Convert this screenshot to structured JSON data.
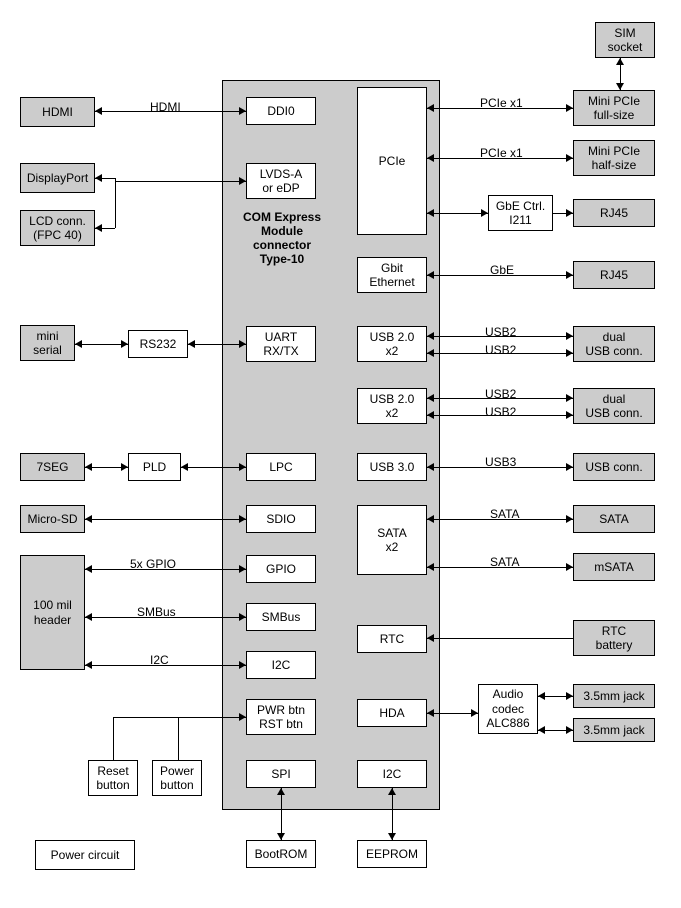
{
  "main": {
    "title": "COM Express\nModule\nconnector\nType-10"
  },
  "left_ext": {
    "hdmi": "HDMI",
    "displayport": "DisplayPort",
    "lcd": "LCD conn.\n(FPC 40)",
    "mini_serial": "mini\nserial",
    "seg7": "7SEG",
    "microsd": "Micro-SD",
    "header100": "100 mil\nheader",
    "power_circuit": "Power circuit"
  },
  "left_mid": {
    "rs232": "RS232",
    "pld": "PLD",
    "reset": "Reset\nbutton",
    "power": "Power\nbutton"
  },
  "left_inner": {
    "ddi0": "DDI0",
    "lvds": "LVDS-A\nor eDP",
    "uart": "UART\nRX/TX",
    "lpc": "LPC",
    "sdio": "SDIO",
    "gpio": "GPIO",
    "smbus": "SMBus",
    "i2c": "I2C",
    "pwrbtn": "PWR btn\nRST btn",
    "spi": "SPI"
  },
  "right_inner": {
    "pcie": "PCIe",
    "gbit": "Gbit\nEthernet",
    "usb20a": "USB 2.0\nx2",
    "usb20b": "USB 2.0\nx2",
    "usb30": "USB 3.0",
    "sata": "SATA\nx2",
    "rtc": "RTC",
    "hda": "HDA",
    "i2c": "I2C"
  },
  "right_mid": {
    "gbectrl": "GbE Ctrl.\nI211",
    "alc886": "Audio\ncodec\nALC886"
  },
  "right_ext": {
    "sim": "SIM\nsocket",
    "minipcie_full": "Mini PCIe\nfull-size",
    "minipcie_half": "Mini PCIe\nhalf-size",
    "rj45a": "RJ45",
    "rj45b": "RJ45",
    "usbconn_a": "dual\nUSB conn.",
    "usbconn_b": "dual\nUSB conn.",
    "usbconn_c": "USB conn.",
    "sata": "SATA",
    "msata": "mSATA",
    "rtcbatt": "RTC\nbattery",
    "jack1": "3.5mm jack",
    "jack2": "3.5mm jack"
  },
  "bottom": {
    "bootrom": "BootROM",
    "eeprom": "EEPROM"
  },
  "labels": {
    "hdmi": "HDMI",
    "pcie_x1a": "PCIe x1",
    "pcie_x1b": "PCIe x1",
    "gbe": "GbE",
    "usb2": "USB2",
    "usb3": "USB3",
    "sata": "SATA",
    "gpio5": "5x GPIO",
    "smbus": "SMBus",
    "i2c": "I2C"
  }
}
